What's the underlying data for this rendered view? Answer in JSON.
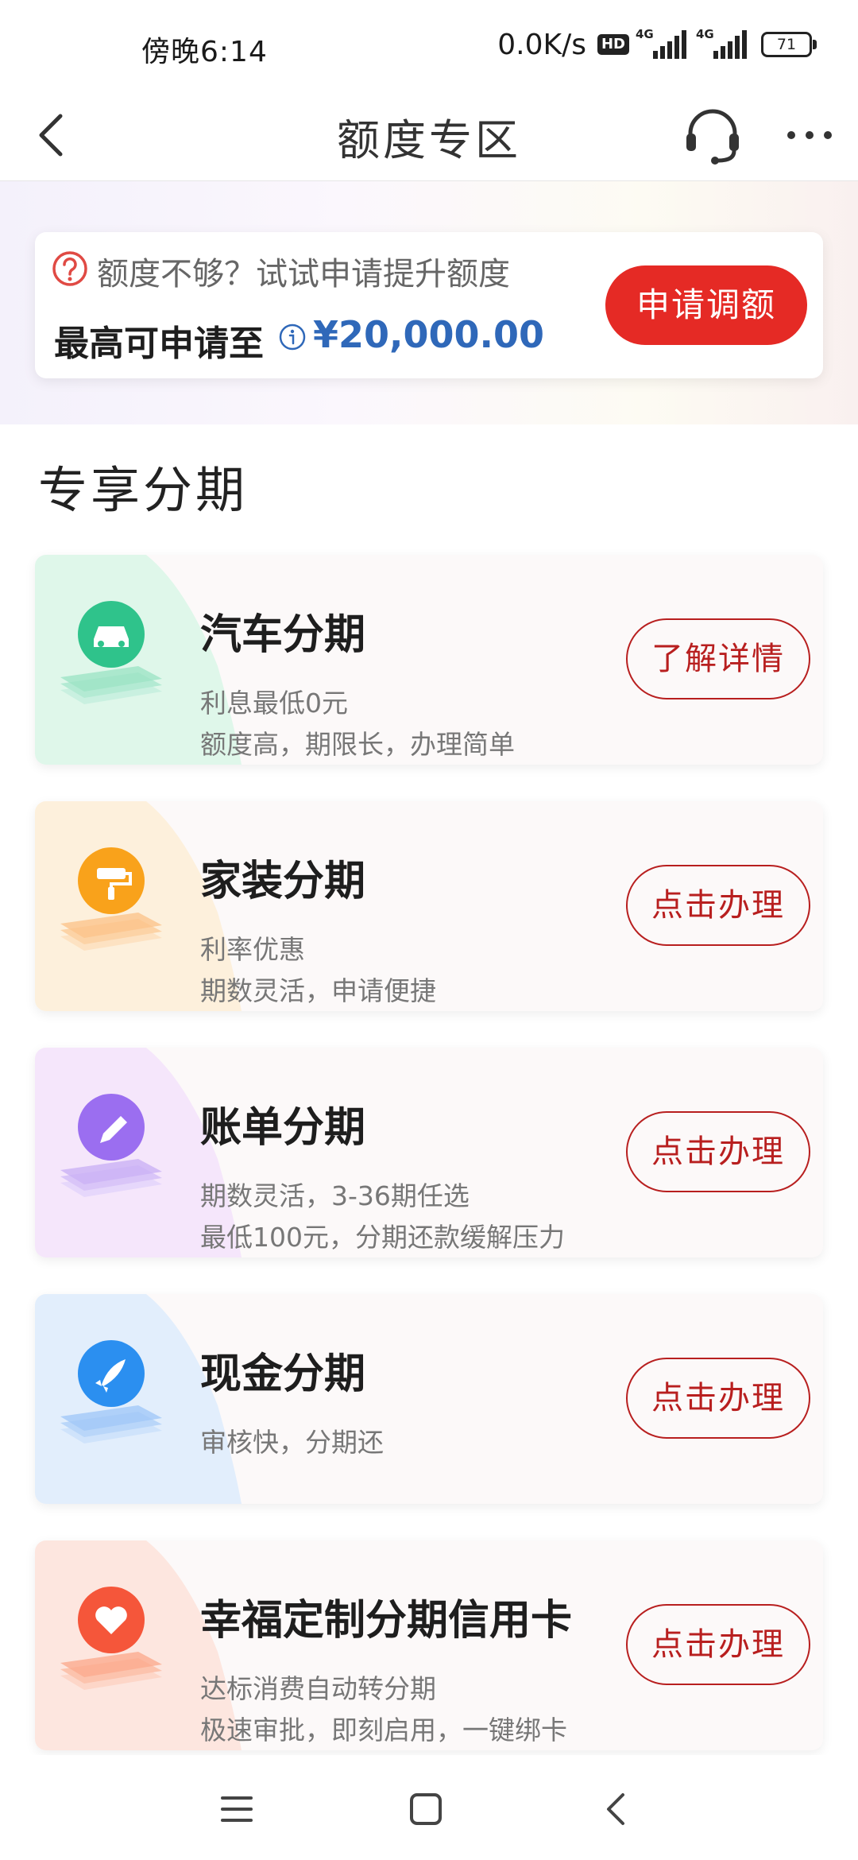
{
  "status_bar": {
    "time": "傍晚6:14",
    "net_speed": "0.0K/s",
    "hd_badge": "HD",
    "signal1_label": "4G",
    "signal2_label": "4G",
    "battery": "71"
  },
  "nav": {
    "title": "额度专区",
    "icons": [
      "back-arrow-icon",
      "headset-icon",
      "more-icon"
    ]
  },
  "quota_card": {
    "tip": "额度不够？试试申请提升额度",
    "label": "最高可申请至",
    "amount": "¥20,000.00",
    "apply_label": "申请调额"
  },
  "section": {
    "title": "专享分期"
  },
  "products": [
    {
      "title": "汽车分期",
      "line1": "利息最低0元",
      "line2": "额度高，期限长，办理简单",
      "button": "了解详情",
      "icon": "car-icon",
      "accent": "#2fc38b"
    },
    {
      "title": "家装分期",
      "line1": "利率优惠",
      "line2": "期数灵活，申请便捷",
      "button": "点击办理",
      "icon": "paint-roller-icon",
      "accent": "#f9a21b"
    },
    {
      "title": "账单分期",
      "line1": "期数灵活，3-36期任选",
      "line2": "最低100元，分期还款缓解压力",
      "button": "点击办理",
      "icon": "pen-icon",
      "accent": "#9b6ef0"
    },
    {
      "title": "现金分期",
      "line1": "审核快，分期还",
      "line2": "",
      "button": "点击办理",
      "icon": "rocket-icon",
      "accent": "#2b8ff0"
    },
    {
      "title": "幸福定制分期信用卡",
      "line1": "达标消费自动转分期",
      "line2": "极速审批，即刻启用，一键绑卡",
      "button": "点击办理",
      "icon": "heart-icon",
      "accent": "#f5563a"
    }
  ],
  "system_nav": {
    "icons": [
      "menu-icon",
      "home-icon",
      "back-icon"
    ]
  }
}
